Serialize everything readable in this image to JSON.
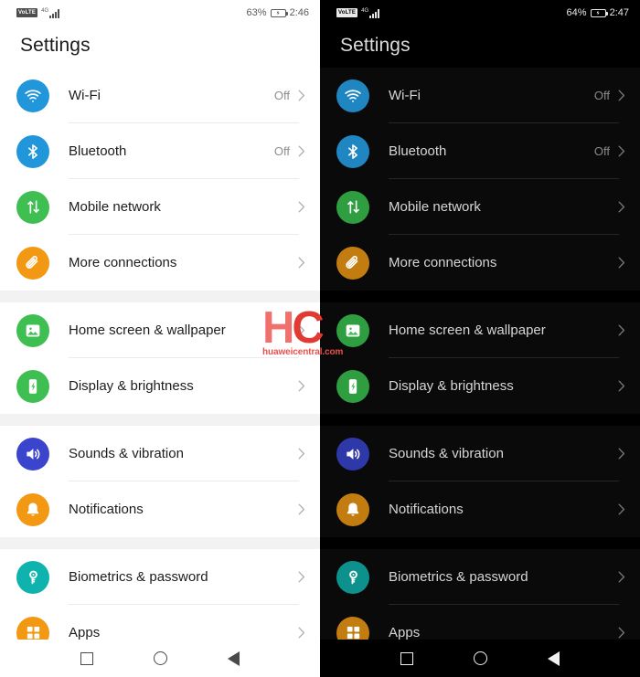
{
  "panels": [
    {
      "theme": "light",
      "status": {
        "volte_badge": "VoLTE",
        "network_type": "4G",
        "signal_icon": "signal-bars-icon",
        "battery_percent": "63%",
        "battery_icon": "battery-charging-icon",
        "clock": "2:46"
      },
      "title": "Settings",
      "nav": {
        "recents_label": "recents-square-icon",
        "home_label": "home-circle-icon",
        "back_label": "back-triangle-icon"
      },
      "groups": [
        {
          "rows": [
            {
              "icon": "wifi-icon",
              "label": "Wi-Fi",
              "value": "Off",
              "color": "#2196db"
            },
            {
              "icon": "bluetooth-icon",
              "label": "Bluetooth",
              "value": "Off",
              "color": "#2196db"
            },
            {
              "icon": "mobile-network-icon",
              "label": "Mobile network",
              "value": "",
              "color": "#3fbf52"
            },
            {
              "icon": "paperclip-icon",
              "label": "More connections",
              "value": "",
              "color": "#f29813"
            }
          ]
        },
        {
          "rows": [
            {
              "icon": "wallpaper-icon",
              "label": "Home screen & wallpaper",
              "value": "",
              "color": "#3fbf52"
            },
            {
              "icon": "display-icon",
              "label": "Display & brightness",
              "value": "",
              "color": "#3fbf52"
            }
          ]
        },
        {
          "rows": [
            {
              "icon": "speaker-icon",
              "label": "Sounds & vibration",
              "value": "",
              "color": "#3a44cc"
            },
            {
              "icon": "bell-icon",
              "label": "Notifications",
              "value": "",
              "color": "#f29813"
            }
          ]
        },
        {
          "rows": [
            {
              "icon": "key-icon",
              "label": "Biometrics & password",
              "value": "",
              "color": "#0fb3ad"
            },
            {
              "icon": "apps-grid-icon",
              "label": "Apps",
              "value": "",
              "color": "#f29813"
            }
          ]
        }
      ]
    },
    {
      "theme": "dark",
      "status": {
        "volte_badge": "VoLTE",
        "network_type": "4G",
        "signal_icon": "signal-bars-icon",
        "battery_percent": "64%",
        "battery_icon": "battery-charging-icon",
        "clock": "2:47"
      },
      "title": "Settings",
      "nav": {
        "recents_label": "recents-square-icon",
        "home_label": "home-circle-icon",
        "back_label": "back-triangle-icon"
      },
      "groups": [
        {
          "rows": [
            {
              "icon": "wifi-icon",
              "label": "Wi-Fi",
              "value": "Off",
              "color": "#1f86c2"
            },
            {
              "icon": "bluetooth-icon",
              "label": "Bluetooth",
              "value": "Off",
              "color": "#1f86c2"
            },
            {
              "icon": "mobile-network-icon",
              "label": "Mobile network",
              "value": "",
              "color": "#2f9e41"
            },
            {
              "icon": "paperclip-icon",
              "label": "More connections",
              "value": "",
              "color": "#c27c10"
            }
          ]
        },
        {
          "rows": [
            {
              "icon": "wallpaper-icon",
              "label": "Home screen & wallpaper",
              "value": "",
              "color": "#2f9e41"
            },
            {
              "icon": "display-icon",
              "label": "Display & brightness",
              "value": "",
              "color": "#2f9e41"
            }
          ]
        },
        {
          "rows": [
            {
              "icon": "speaker-icon",
              "label": "Sounds & vibration",
              "value": "",
              "color": "#2f38a8"
            },
            {
              "icon": "bell-icon",
              "label": "Notifications",
              "value": "",
              "color": "#c27c10"
            }
          ]
        },
        {
          "rows": [
            {
              "icon": "key-icon",
              "label": "Biometrics & password",
              "value": "",
              "color": "#0d918d"
            },
            {
              "icon": "apps-grid-icon",
              "label": "Apps",
              "value": "",
              "color": "#c27c10"
            }
          ]
        }
      ]
    }
  ],
  "watermark": {
    "letter_h": "H",
    "letter_c": "C",
    "site": "huaweicentral.com"
  }
}
